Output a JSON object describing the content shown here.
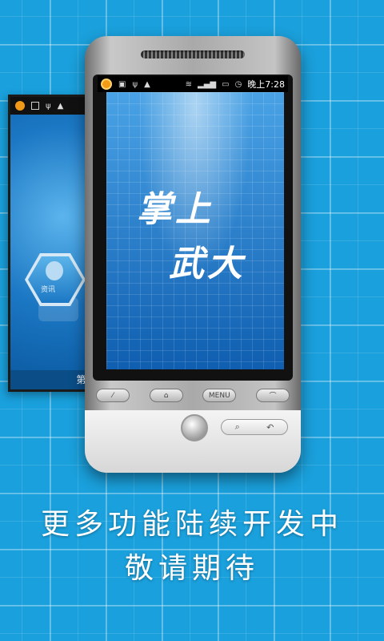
{
  "status_bar": {
    "time": "晚上7:28"
  },
  "splash": {
    "title_line1": "掌上",
    "title_line2": "武大"
  },
  "back_phone": {
    "tile_label": "资讯",
    "page_indicator": "第8"
  },
  "hardware_buttons": {
    "menu_label": "MENU"
  },
  "caption": {
    "line1": "更多功能陆续开发中",
    "line2": "敬请期待"
  },
  "colors": {
    "background": "#1aa0dc",
    "screen": "#2f8bd6",
    "status_accent": "#f39a16"
  }
}
